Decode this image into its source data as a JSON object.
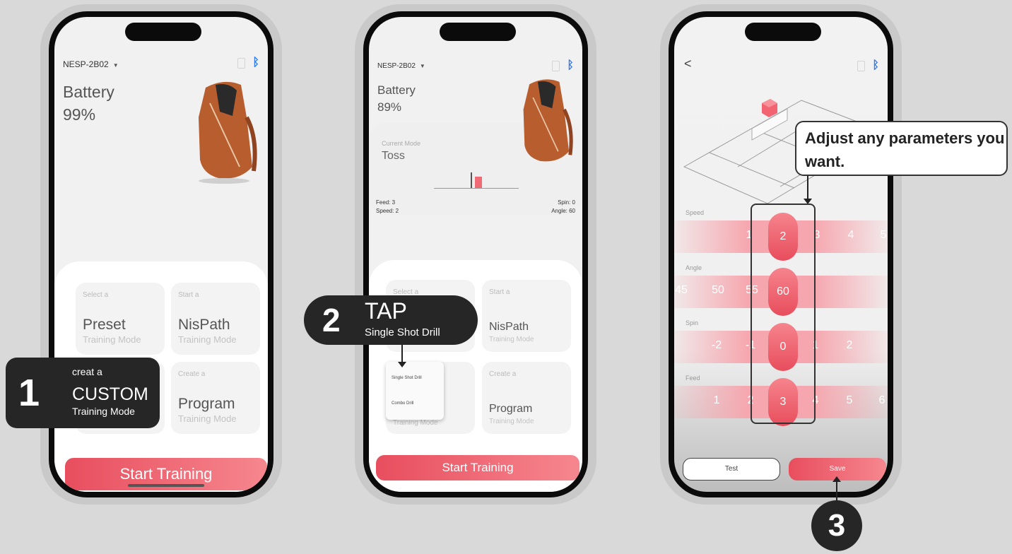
{
  "phones": [
    {
      "device_name": "NESP-2B02",
      "battery_label": "Battery",
      "battery_value": "99%",
      "cards": [
        {
          "small": "Select a",
          "title": "Preset",
          "mode": "Training Mode"
        },
        {
          "small": "Start a",
          "title": "NisPath",
          "mode": "Training Mode"
        },
        {
          "small": "Create a",
          "title": "Program",
          "mode": "Training Mode"
        }
      ],
      "start_button": "Start Training"
    },
    {
      "device_name": "NESP-2B02",
      "battery_label": "Battery",
      "battery_value": "89%",
      "current_mode_label": "Current Mode",
      "current_mode_value": "Toss",
      "feed": "Feed: 3",
      "speed": "Speed: 2",
      "spin": "Spin: 0",
      "angle": "Angle: 60",
      "cards": [
        {
          "small": "Select a",
          "title": "",
          "mode": ""
        },
        {
          "small": "Start a",
          "title": "NisPath",
          "mode": "Training Mode"
        },
        {
          "small": "",
          "title": "",
          "mode": "Training Mode"
        },
        {
          "small": "Create a",
          "title": "Program",
          "mode": "Training Mode"
        }
      ],
      "popup": {
        "item1": "Single Shot Drill",
        "item2": "Combo Drill"
      },
      "start_button": "Start Training"
    },
    {
      "back": "<",
      "rows": [
        {
          "label": "Speed",
          "values": [
            "1",
            "2",
            "3",
            "4",
            "5"
          ],
          "selected": "2"
        },
        {
          "label": "Angle",
          "values": [
            "45",
            "50",
            "55",
            "60"
          ],
          "selected": "60"
        },
        {
          "label": "Spin",
          "values": [
            "-2",
            "-1",
            "0",
            "1",
            "2"
          ],
          "selected": "0"
        },
        {
          "label": "Feed",
          "values": [
            "1",
            "2",
            "3",
            "4",
            "5",
            "6"
          ],
          "selected": "3"
        }
      ],
      "test_button": "Test",
      "save_button": "Save"
    }
  ],
  "callouts": {
    "step1": {
      "number": "1",
      "line1": "creat a",
      "line2": "CUSTOM",
      "line3": "Training Mode"
    },
    "step2": {
      "number": "2",
      "line1": "TAP",
      "line2": "Single Shot Drill"
    },
    "step3": {
      "number": "3",
      "text": "Adjust any parameters you want."
    }
  },
  "colors": {
    "accent": "#e84e5e",
    "bluetooth": "#2f7df6",
    "callout_bg": "#262626",
    "page_bg": "#d9d9d9"
  }
}
